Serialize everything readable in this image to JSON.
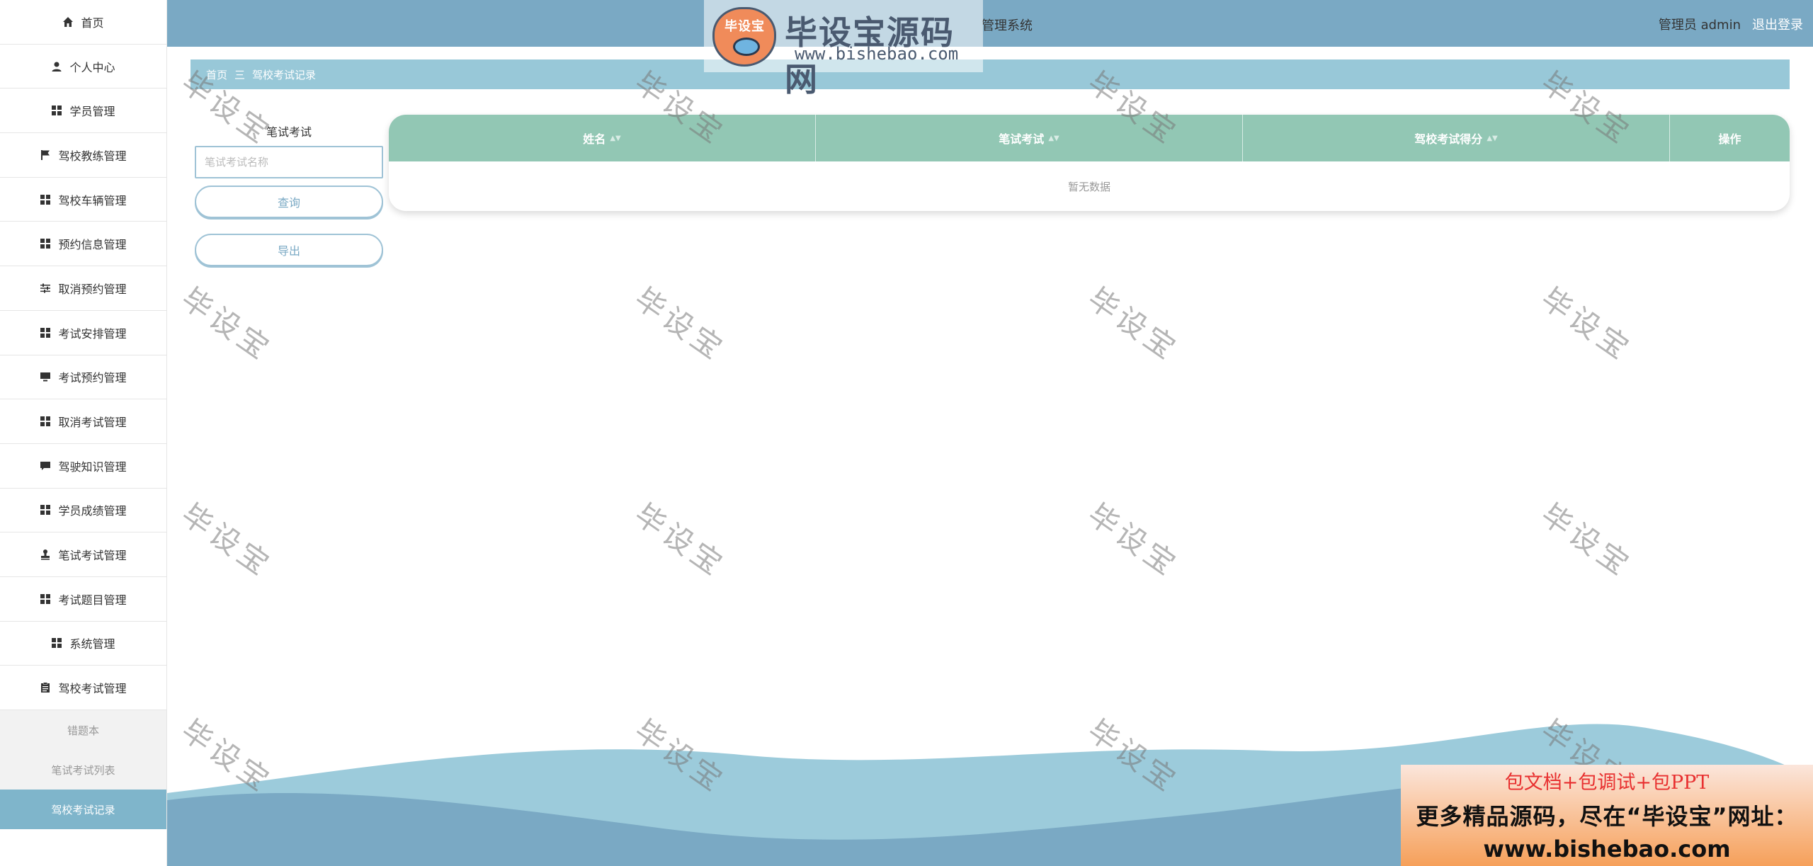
{
  "sidebar": {
    "items": [
      {
        "label": "首页",
        "icon": "home-icon"
      },
      {
        "label": "个人中心",
        "icon": "user-icon"
      },
      {
        "label": "学员管理",
        "icon": "grid-icon"
      },
      {
        "label": "驾校教练管理",
        "icon": "flag-icon"
      },
      {
        "label": "驾校车辆管理",
        "icon": "grid-icon"
      },
      {
        "label": "预约信息管理",
        "icon": "grid-icon"
      },
      {
        "label": "取消预约管理",
        "icon": "sliders-icon"
      },
      {
        "label": "考试安排管理",
        "icon": "grid-icon"
      },
      {
        "label": "考试预约管理",
        "icon": "monitor-icon"
      },
      {
        "label": "取消考试管理",
        "icon": "grid-icon"
      },
      {
        "label": "驾驶知识管理",
        "icon": "chat-icon"
      },
      {
        "label": "学员成绩管理",
        "icon": "grid-icon"
      },
      {
        "label": "笔试考试管理",
        "icon": "stamp-icon"
      },
      {
        "label": "考试题目管理",
        "icon": "grid-icon"
      },
      {
        "label": "系统管理",
        "icon": "grid-icon"
      },
      {
        "label": "驾校考试管理",
        "icon": "clipboard-icon"
      }
    ],
    "submenu": [
      {
        "label": "错题本"
      },
      {
        "label": "笔试考试列表"
      },
      {
        "label": "驾校考试记录"
      }
    ]
  },
  "header": {
    "system_title": "管理系统",
    "user_label": "管理员 admin",
    "logout_label": "退出登录"
  },
  "watermark": {
    "brand": "毕设宝源码网",
    "badge": "毕设宝",
    "url": "www.bishebao.com",
    "repeat_text": "毕设宝"
  },
  "breadcrumb": {
    "home": "首页",
    "separator": "三",
    "current": "驾校考试记录"
  },
  "search": {
    "label": "笔试考试",
    "placeholder": "笔试考试名称",
    "query_label": "查询",
    "export_label": "导出"
  },
  "table": {
    "columns": [
      "姓名",
      "笔试考试",
      "驾校考试得分",
      "操作"
    ],
    "empty_text": "暂无数据"
  },
  "ad": {
    "line1": "包文档+包调试+包PPT",
    "line2": "更多精品源码，尽在“毕设宝”网址：",
    "line3": "www.bishebao.com"
  },
  "colors": {
    "header_bg": "#7aa9c4",
    "breadcrumb_bg": "#98c8d8",
    "table_header_bg": "#92c7b4",
    "active_sub_bg": "#7fb5cb"
  }
}
